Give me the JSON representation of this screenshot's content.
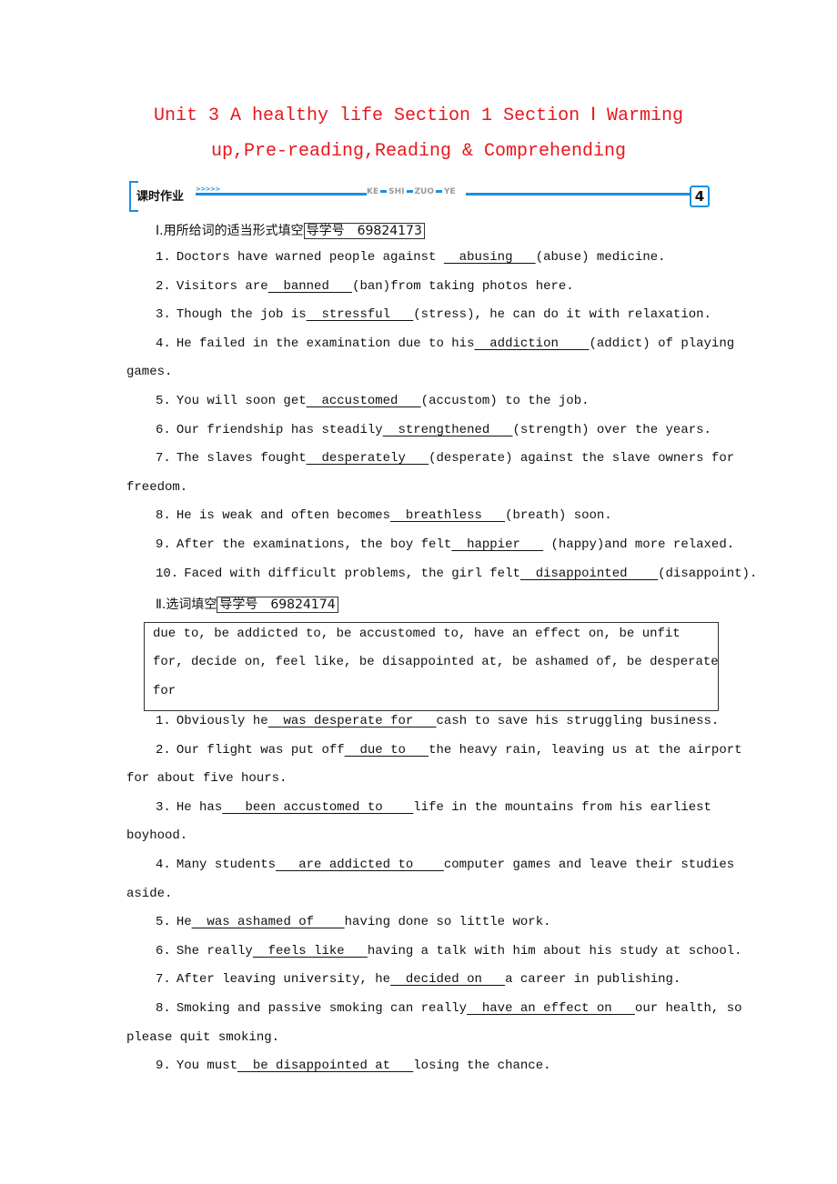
{
  "document": {
    "title_line1": "Unit 3 A healthy life Section 1 Section Ⅰ Warming",
    "title_line2": "up,Pre-reading,Reading & Comprehending",
    "banner": {
      "label": "课时作业",
      "arrows": ">>>>>",
      "pinyin": [
        "KE",
        "SHI",
        "ZUO",
        "YE"
      ],
      "number": "4"
    },
    "part1": {
      "heading": "Ⅰ.用所给词的适当形式填空",
      "guide_id": "导学号　69824173",
      "items": [
        {
          "num": "1.",
          "pre": "Doctors have warned people against ",
          "answer": "  abusing   ",
          "post": "(abuse) medicine."
        },
        {
          "num": "2.",
          "pre": "Visitors are",
          "answer": "  banned   ",
          "post": "(ban)from taking photos here."
        },
        {
          "num": "3.",
          "pre": "Though the job is",
          "answer": "  stressful   ",
          "post": "(stress), he can do it with relaxation."
        },
        {
          "num": "4.",
          "pre": "He failed in the examination due to his",
          "answer": "  addiction    ",
          "post": "(addict) of playing",
          "cont": "games."
        },
        {
          "num": "5.",
          "pre": "You will soon get",
          "answer": "  accustomed   ",
          "post": "(accustom) to the job."
        },
        {
          "num": "6.",
          "pre": "Our friendship has steadily",
          "answer": "  strengthened   ",
          "post": "(strength) over the years."
        },
        {
          "num": "7.",
          "pre": "The slaves fought",
          "answer": "  desperately   ",
          "post": "(desperate) against the slave owners for",
          "cont": "freedom."
        },
        {
          "num": "8.",
          "pre": "He is weak and often becomes",
          "answer": "  breathless   ",
          "post": "(breath) soon."
        },
        {
          "num": "9.",
          "pre": "After the examinations, the boy felt",
          "answer": "  happier   ",
          "post": " (happy)and more relaxed."
        },
        {
          "num": "10.",
          "pre": "Faced with difficult problems, the girl felt",
          "answer": "  disappointed    ",
          "post": "(disappoint)."
        }
      ]
    },
    "part2": {
      "heading": "Ⅱ.选词填空",
      "guide_id": "导学号　69824174",
      "word_bank_lines": [
        "due to,  be addicted to,  be accustomed to,  have an effect on,  be unfit",
        "for,  decide on,  feel like,  be disappointed at, be ashamed of,  be desperate",
        "for"
      ],
      "items": [
        {
          "num": "1.",
          "pre": "Obviously he",
          "answer": "  was desperate for   ",
          "post": "cash to save his struggling business."
        },
        {
          "num": "2.",
          "pre": "Our flight was put off",
          "answer": "  due to   ",
          "post": "the heavy rain, leaving us at the airport",
          "cont": "for about five hours."
        },
        {
          "num": "3.",
          "pre": "He has",
          "answer": "   been accustomed to    ",
          "post": "life in the mountains from his earliest",
          "cont": "boyhood."
        },
        {
          "num": "4.",
          "pre": "Many students",
          "answer": "   are addicted to    ",
          "post": "computer games and leave their studies",
          "cont": "aside."
        },
        {
          "num": "5.",
          "pre": "He",
          "answer": "  was ashamed of    ",
          "post": "having done so little work."
        },
        {
          "num": "6.",
          "pre": "She really",
          "answer": "  feels like   ",
          "post": "having a talk with him about his study at school."
        },
        {
          "num": "7.",
          "pre": "After leaving university, he",
          "answer": "  decided on   ",
          "post": "a career in publishing."
        },
        {
          "num": "8.",
          "pre": "Smoking and passive smoking can really",
          "answer": "  have an effect on   ",
          "post": "our health, so",
          "cont": "please quit smoking."
        },
        {
          "num": "9.",
          "pre": "You must",
          "answer": "  be disappointed at   ",
          "post": "losing the chance."
        }
      ]
    }
  }
}
